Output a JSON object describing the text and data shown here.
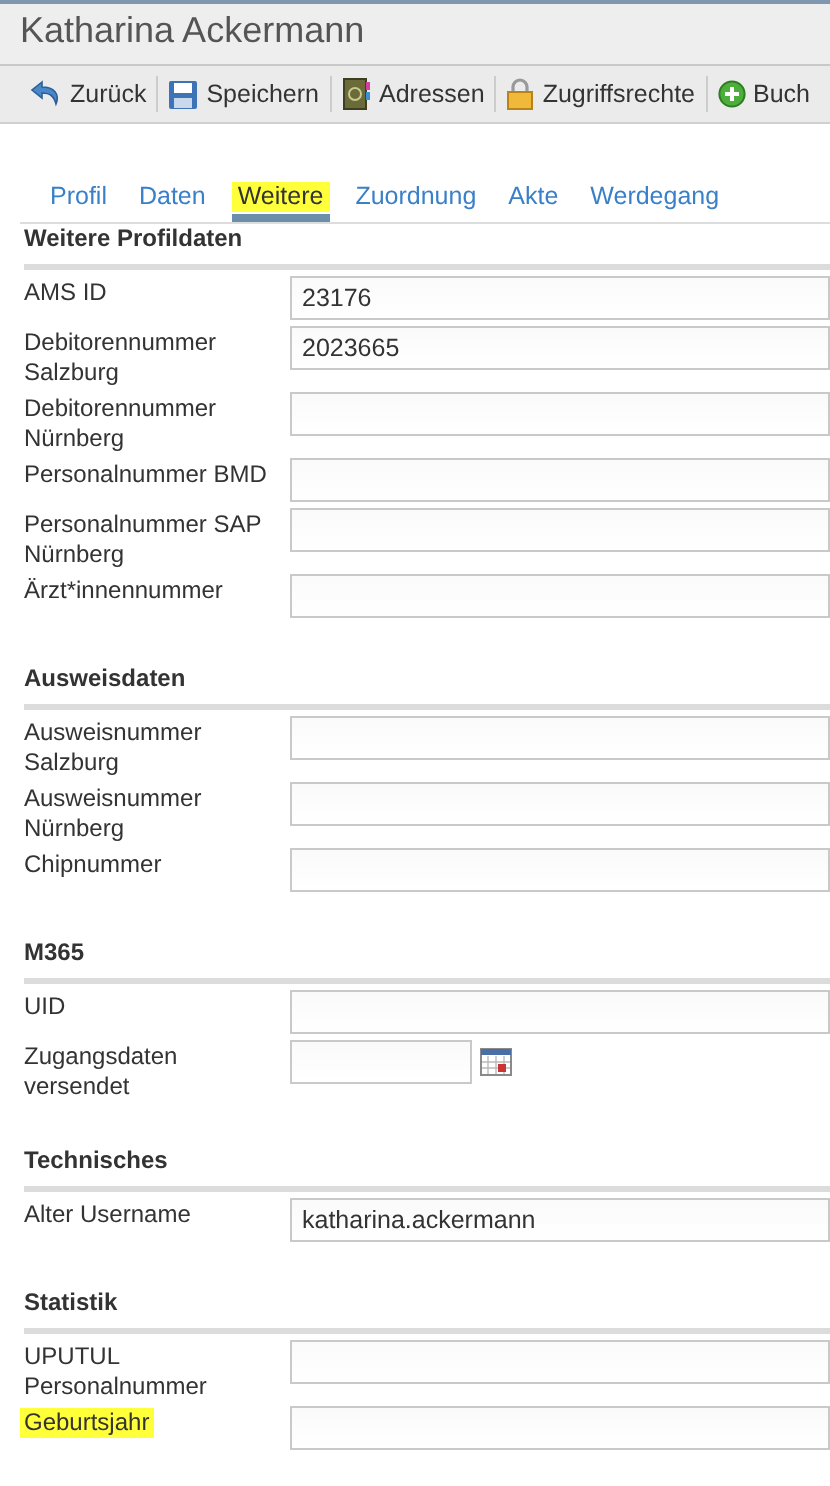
{
  "window": {
    "title": "Katharina Ackermann"
  },
  "toolbar": [
    {
      "kind": "back",
      "label": "Zurück"
    },
    {
      "kind": "save",
      "label": "Speichern"
    },
    {
      "kind": "book",
      "label": "Adressen"
    },
    {
      "kind": "lock",
      "label": "Zugriffsrechte"
    },
    {
      "kind": "add",
      "label": "Buch"
    }
  ],
  "tabs": [
    {
      "label": "Profil",
      "selected": false,
      "highlighted": false
    },
    {
      "label": "Daten",
      "selected": false,
      "highlighted": false
    },
    {
      "label": "Weitere",
      "selected": true,
      "highlighted": true
    },
    {
      "label": "Zuordnung",
      "selected": false,
      "highlighted": false
    },
    {
      "label": "Akte",
      "selected": false,
      "highlighted": false
    },
    {
      "label": "Werdegang",
      "selected": false,
      "highlighted": false
    }
  ],
  "sections": [
    {
      "title": "Weitere Profildaten",
      "fields": [
        {
          "kind": "text",
          "label": "AMS ID",
          "value": "23176",
          "highlighted": false
        },
        {
          "kind": "text",
          "label": "Debitorennummer Salzburg",
          "value": "2023665",
          "highlighted": false
        },
        {
          "kind": "text",
          "label": "Debitorennummer Nürnberg",
          "highlighted": false
        },
        {
          "kind": "text",
          "label": "Personalnummer BMD",
          "highlighted": false
        },
        {
          "kind": "text",
          "label": "Personalnummer SAP Nürnberg",
          "highlighted": false
        },
        {
          "kind": "text",
          "label": "Ärzt*innennummer",
          "highlighted": false
        }
      ]
    },
    {
      "title": "Ausweisdaten",
      "fields": [
        {
          "kind": "text",
          "label": "Ausweisnummer Salzburg",
          "highlighted": false
        },
        {
          "kind": "text",
          "label": "Ausweisnummer Nürnberg",
          "highlighted": false
        },
        {
          "kind": "text",
          "label": "Chipnummer",
          "highlighted": false
        }
      ]
    },
    {
      "title": "M365",
      "fields": [
        {
          "kind": "text",
          "label": "UID",
          "highlighted": false
        },
        {
          "kind": "date",
          "label": "Zugangsdaten versendet",
          "highlighted": false
        }
      ]
    },
    {
      "title": "Technisches",
      "fields": [
        {
          "kind": "text",
          "label": "Alter Username",
          "value": "katharina.ackermann",
          "highlighted": false
        }
      ]
    },
    {
      "title": "Statistik",
      "fields": [
        {
          "kind": "text",
          "label": "UPUTUL Personalnummer",
          "highlighted": false
        },
        {
          "kind": "text",
          "label": "Geburtsjahr",
          "highlighted": true
        }
      ]
    }
  ]
}
